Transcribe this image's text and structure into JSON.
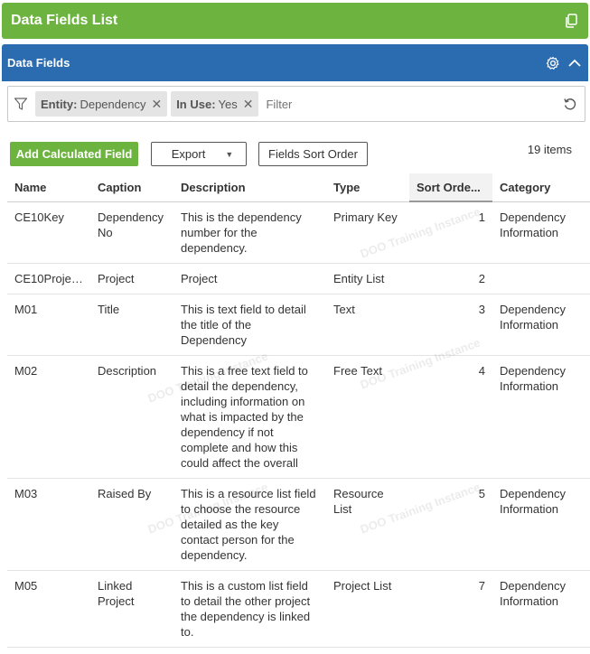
{
  "top_bar": {
    "title": "Data Fields List",
    "icon": "copy-icon"
  },
  "panel": {
    "title": "Data Fields",
    "settings_icon": "gear-icon",
    "collapse_icon": "chevron-up-icon"
  },
  "filter": {
    "chips": [
      {
        "label": "Entity:",
        "value": "Dependency"
      },
      {
        "label": "In Use:",
        "value": "Yes"
      }
    ],
    "placeholder": "Filter"
  },
  "toolbar": {
    "add_label": "Add Calculated Field",
    "export_label": "Export",
    "sort_order_label": "Fields Sort Order",
    "items_count": "19 items"
  },
  "table": {
    "columns": [
      "Name",
      "Caption",
      "Description",
      "Type",
      "Sort Orde...",
      "Category"
    ],
    "rows": [
      {
        "name": "CE10Key",
        "caption": "Dependency No",
        "description": "This is the dependency number for the dependency.",
        "type": "Primary Key",
        "sort": "1",
        "category": "Dependency Information"
      },
      {
        "name": "CE10Projec...",
        "caption": "Project",
        "description": "Project",
        "type": "Entity List",
        "sort": "2",
        "category": ""
      },
      {
        "name": "M01",
        "caption": "Title",
        "description": "This is text field to detail the title of the Dependency",
        "type": "Text",
        "sort": "3",
        "category": "Dependency Information"
      },
      {
        "name": "M02",
        "caption": "Description",
        "description": "This is a free text field to detail the dependency, including information on what is impacted by the dependency if not complete and how this could affect the overall",
        "type": "Free Text",
        "sort": "4",
        "category": "Dependency Information"
      },
      {
        "name": "M03",
        "caption": "Raised By",
        "description": "This is a resource list field to choose the resource detailed as the key contact person for the dependency.",
        "type": "Resource List",
        "sort": "5",
        "category": "Dependency Information"
      },
      {
        "name": "M05",
        "caption": "Linked Project",
        "description": "This is a custom list field to detail the other project the dependency is linked to.",
        "type": "Project List",
        "sort": "7",
        "category": "Dependency Information"
      }
    ]
  },
  "watermark_text": "DOO Training Instance",
  "colors": {
    "green": "#6db33f",
    "blue": "#2b6cb0"
  }
}
